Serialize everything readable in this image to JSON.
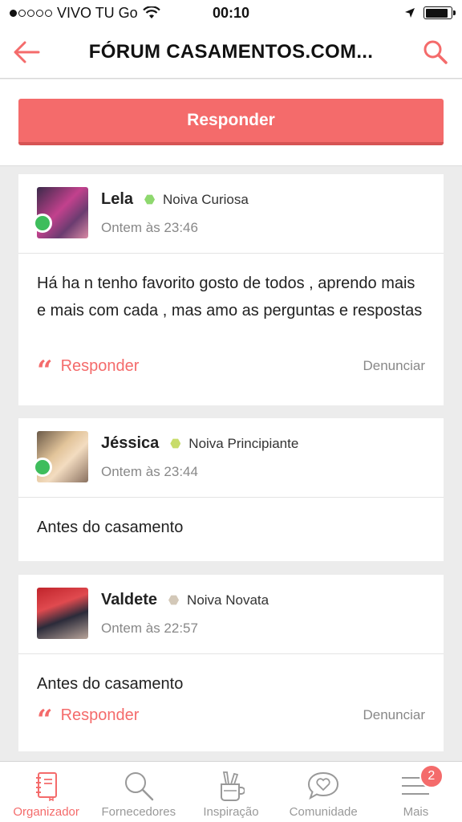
{
  "status_bar": {
    "carrier": "VIVO TU Go",
    "time": "00:10"
  },
  "header": {
    "title": "FÓRUM CASAMENTOS.COM...",
    "back_icon": "arrow-left-icon",
    "search_icon": "search-icon"
  },
  "reply_button": {
    "label": "Responder"
  },
  "posts": [
    {
      "username": "Lela",
      "rank": "Noiva Curiosa",
      "rank_color": "#8ed86e",
      "time": "Ontem às 23:46",
      "body": "Há ha n tenho favorito gosto de todos , aprendo mais e mais com cada , mas amo as perguntas e respostas",
      "reply_label": "Responder",
      "report_label": "Denunciar",
      "online": true
    },
    {
      "username": "Jéssica",
      "rank": "Noiva Principiante",
      "rank_color": "#c8dc6a",
      "time": "Ontem às 23:44",
      "body": "Antes do casamento",
      "online": true
    },
    {
      "username": "Valdete",
      "rank": "Noiva Novata",
      "rank_color": "#d3c8b8",
      "time": "Ontem às 22:57",
      "body": "Antes do casamento",
      "reply_label": "Responder",
      "report_label": "Denunciar",
      "online": false
    }
  ],
  "tab_bar": {
    "tabs": [
      {
        "label": "Organizador",
        "icon": "organizer-book-icon",
        "active": true
      },
      {
        "label": "Fornecedores",
        "icon": "search-icon",
        "active": false
      },
      {
        "label": "Inspiração",
        "icon": "pencil-cup-icon",
        "active": false
      },
      {
        "label": "Comunidade",
        "icon": "heart-chat-icon",
        "active": false
      },
      {
        "label": "Mais",
        "icon": "menu-icon",
        "active": false,
        "badge": "2"
      }
    ]
  },
  "colors": {
    "accent": "#f46b6b",
    "online": "#3ebd5c"
  }
}
